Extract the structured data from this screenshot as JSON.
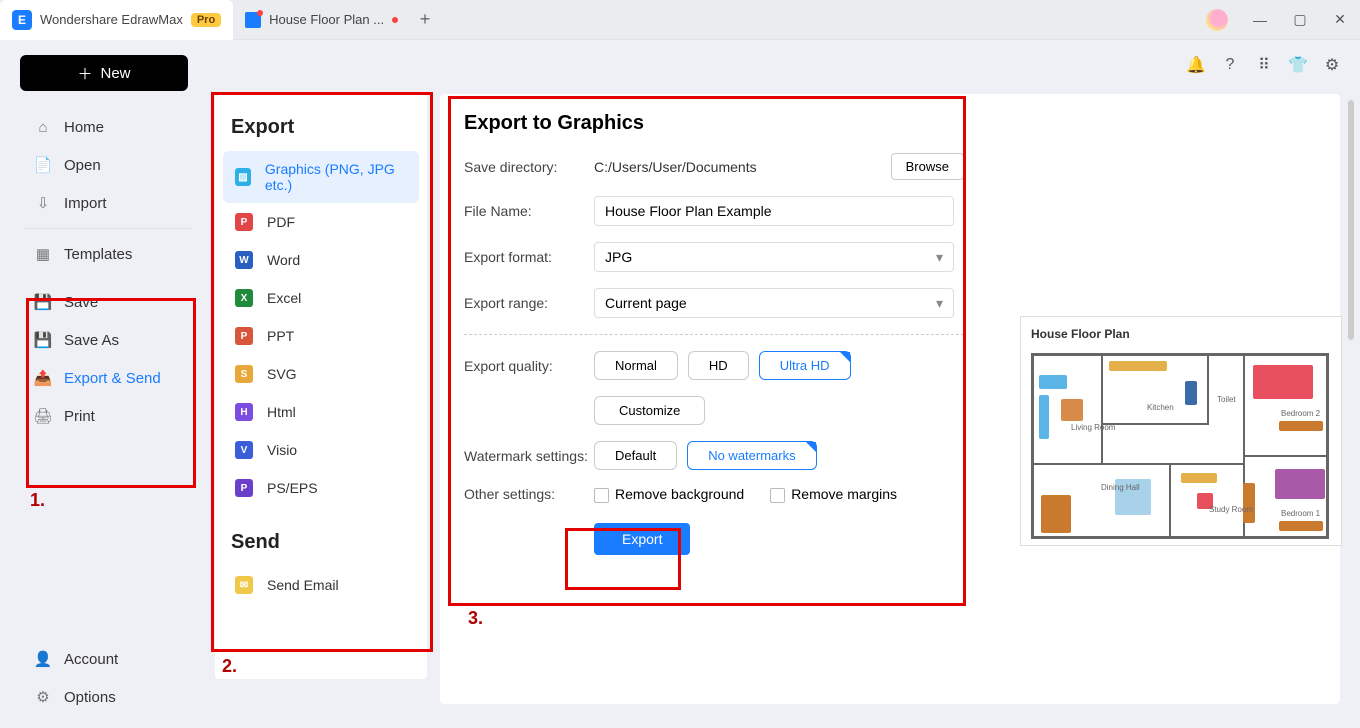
{
  "titlebar": {
    "app_name": "Wondershare EdrawMax",
    "pro_badge": "Pro",
    "doc_tab": "House Floor Plan ..."
  },
  "new_button": "New",
  "nav": {
    "home": "Home",
    "open": "Open",
    "import": "Import",
    "templates": "Templates",
    "save": "Save",
    "saveas": "Save As",
    "exportsend": "Export & Send",
    "print": "Print",
    "account": "Account",
    "options": "Options"
  },
  "annotations": {
    "one": "1.",
    "two": "2.",
    "three": "3."
  },
  "export_panel": {
    "title": "Export",
    "items": {
      "graphics": "Graphics (PNG, JPG etc.)",
      "pdf": "PDF",
      "word": "Word",
      "excel": "Excel",
      "ppt": "PPT",
      "svg": "SVG",
      "html": "Html",
      "visio": "Visio",
      "pseps": "PS/EPS"
    },
    "send_title": "Send",
    "send_email": "Send Email"
  },
  "main": {
    "title": "Export to Graphics",
    "save_dir_label": "Save directory:",
    "save_dir_value": "C:/Users/User/Documents",
    "browse": "Browse",
    "filename_label": "File Name:",
    "filename_value": "House Floor Plan Example",
    "format_label": "Export format:",
    "format_value": "JPG",
    "range_label": "Export range:",
    "range_value": "Current page",
    "quality_label": "Export quality:",
    "quality": {
      "normal": "Normal",
      "hd": "HD",
      "uhd": "Ultra HD",
      "customize": "Customize"
    },
    "watermark_label": "Watermark settings:",
    "watermark": {
      "default": "Default",
      "none": "No watermarks"
    },
    "other_label": "Other settings:",
    "remove_bg": "Remove background",
    "remove_margins": "Remove margins",
    "export_btn": "Export"
  },
  "preview": {
    "title": "House Floor Plan",
    "rooms": {
      "living": "Living Room",
      "kitchen": "Kitchen",
      "toilet": "Toilet",
      "dining": "Dining Hall",
      "study": "Study Room",
      "bed2": "Bedroom 2",
      "bed1": "Bedroom 1"
    }
  }
}
